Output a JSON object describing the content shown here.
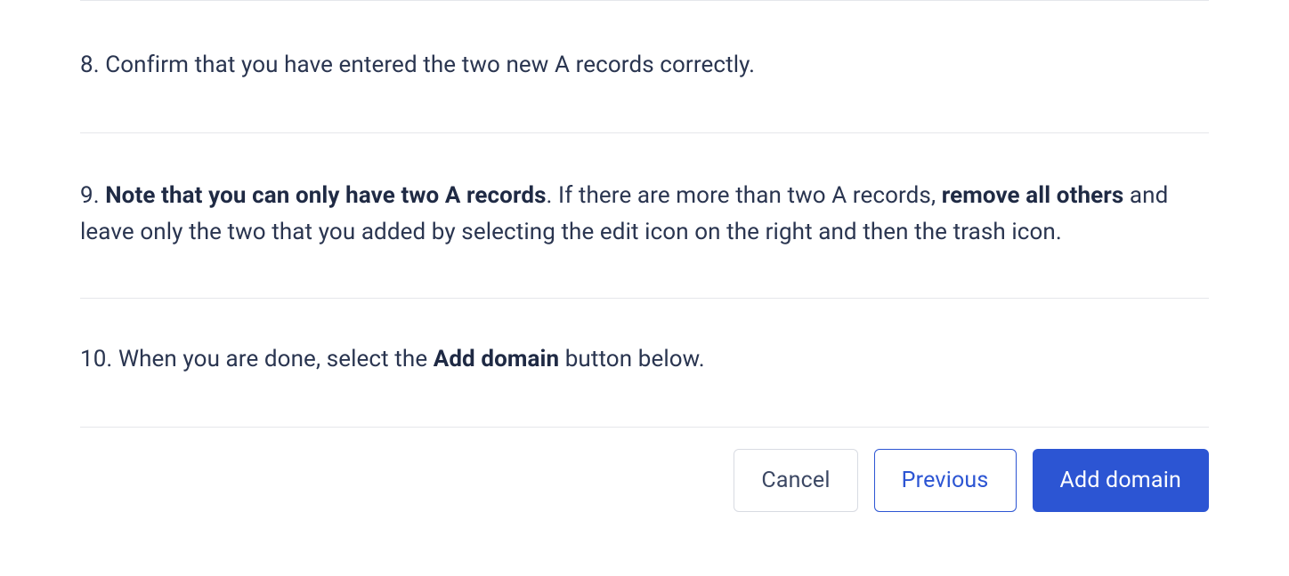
{
  "steps": {
    "s8": {
      "num": "8.",
      "text": "Confirm that you have entered the two new A records correctly."
    },
    "s9": {
      "num": "9.",
      "bold1": "Note that you can only have two A records",
      "mid1": ". If there are more than two A records, ",
      "bold2": "remove all others",
      "mid2": " and leave only the two that you added by selecting the edit icon on the right and then the trash icon."
    },
    "s10": {
      "num": "10.",
      "pre": "When you are done, select the ",
      "bold": "Add domain",
      "post": " button below."
    }
  },
  "buttons": {
    "cancel": "Cancel",
    "previous": "Previous",
    "add_domain": "Add domain"
  }
}
